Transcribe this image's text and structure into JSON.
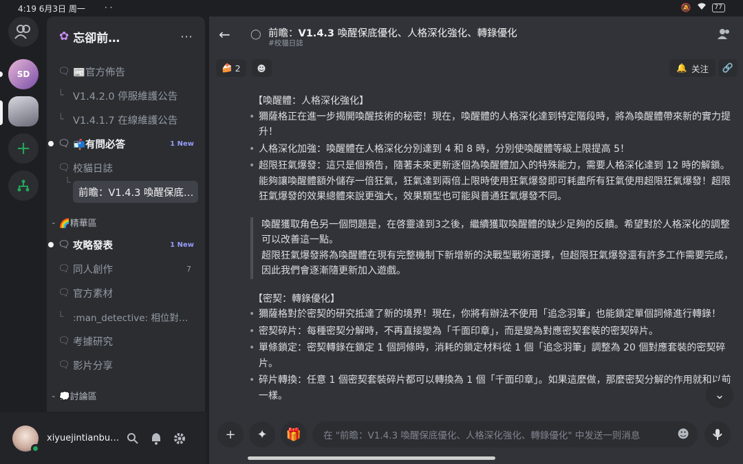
{
  "status_bar": {
    "time": "4:19",
    "date": "6月3日 周一",
    "dots": "·  ·",
    "battery": "77"
  },
  "server": {
    "name": "忘卻前…",
    "more": "⋯"
  },
  "channels": [
    {
      "label": "📰官方佈告",
      "icon": "forum-icon",
      "state": "normal"
    },
    {
      "label": "V1.4.2.0 停服維護公告",
      "icon": "thread-tree",
      "state": "thread"
    },
    {
      "label": "V1.4.1.7 在線維護公告",
      "icon": "thread-tree",
      "state": "thread"
    },
    {
      "label": "📬有問必答",
      "icon": "forum-icon",
      "state": "unread",
      "badge": "1 New"
    },
    {
      "label": "校貓日誌",
      "icon": "forum-icon",
      "state": "normal"
    },
    {
      "label": "前瞻：V1.4.3 喚醒保底…",
      "icon": "thread-tree",
      "state": "selected"
    },
    {
      "label": "攻略發表",
      "icon": "forum-icon",
      "state": "unread",
      "badge": "1 New"
    },
    {
      "label": "同人創作",
      "icon": "forum-icon",
      "state": "normal",
      "count": "7"
    },
    {
      "label": "官方素材",
      "icon": "forum-icon",
      "state": "normal"
    },
    {
      "label": ":man_detective: 相位對…",
      "icon": "thread-tree",
      "state": "thread"
    },
    {
      "label": "考據研究",
      "icon": "forum-icon",
      "state": "normal"
    },
    {
      "label": "影片分享",
      "icon": "forum-icon",
      "state": "normal"
    }
  ],
  "categories": [
    "🌈精華區",
    "💭討論區"
  ],
  "user": {
    "name": "xiyuejintianbuch…"
  },
  "thread": {
    "title_prefix": "前瞻：",
    "title_bold": "V1.4.3",
    "title_rest": " 喚醒保底優化、人格深化強化、轉錄優化",
    "subtitle": "#校貓日誌",
    "reaction_count": "2",
    "follow_label": "关注"
  },
  "content": {
    "h1": "【喚醒體：人格深化強化】",
    "list1": [
      "獮薩格正在進一步揭開喚醒技術的秘密！現在，喚醒體的人格深化達到特定階段時，將為喚醒體帶來新的實力提升！",
      "人格深化加強：喚醒體在人格深化分別達到 4 和 8 時，分別使喚醒體等級上限提高 5！",
      "超限狂氣爆發：這只是個預告，隨著未來更新逐個為喚醒體加入的特殊能力，需要人格深化達到 12 時的解鎖。能夠讓喚醒體額外儲存一倍狂氣，狂氣達到兩倍上限時使用狂氣爆發即可耗盡所有狂氣使用超限狂氣爆發！超限狂氣爆發的效果總體來說更強大，效果類型也可能與普通狂氣爆發不同。"
    ],
    "quote1": "喚醒獲取角色另一個問題是，在啓靈達到3之後，繼續獲取喚醒體的缺少足夠的反饋。希望對於人格深化的調整可以改善這一點。",
    "quote2": "超限狂氣爆發將為喚醒體在現有完整機制下新增新的決戰型戰術選擇，但超限狂氣爆發還有許多工作需要完成，因此我們會逐漸隨更新加入遊戲。",
    "h2": "【密契：轉錄優化】",
    "list2": [
      "獮薩格對於密契的研究抵達了新的境界！現在，你將有辦法不使用「追念羽筆」也能鎖定單個詞條進行轉錄！",
      "密契碎片：每種密契分解時，不再直接變為「千面印章」，而是變為對應密契套裝的密契碎片。",
      "單條鎖定：密契轉錄在鎖定 1 個詞條時，消耗的鎖定材料從 1 個「追念羽筆」調整為 20 個對應套裝的密契碎片。",
      "碎片轉換：任意 1 個密契套裝碎片都可以轉換為 1 個「千面印章」。如果這麼做，那麼密契分解的作用就和以前一樣。"
    ]
  },
  "composer": {
    "placeholder": "在 \"前瞻：V1.4.3 喚醒保底優化、人格深化強化、轉錄優化\" 中发送一则消息"
  }
}
